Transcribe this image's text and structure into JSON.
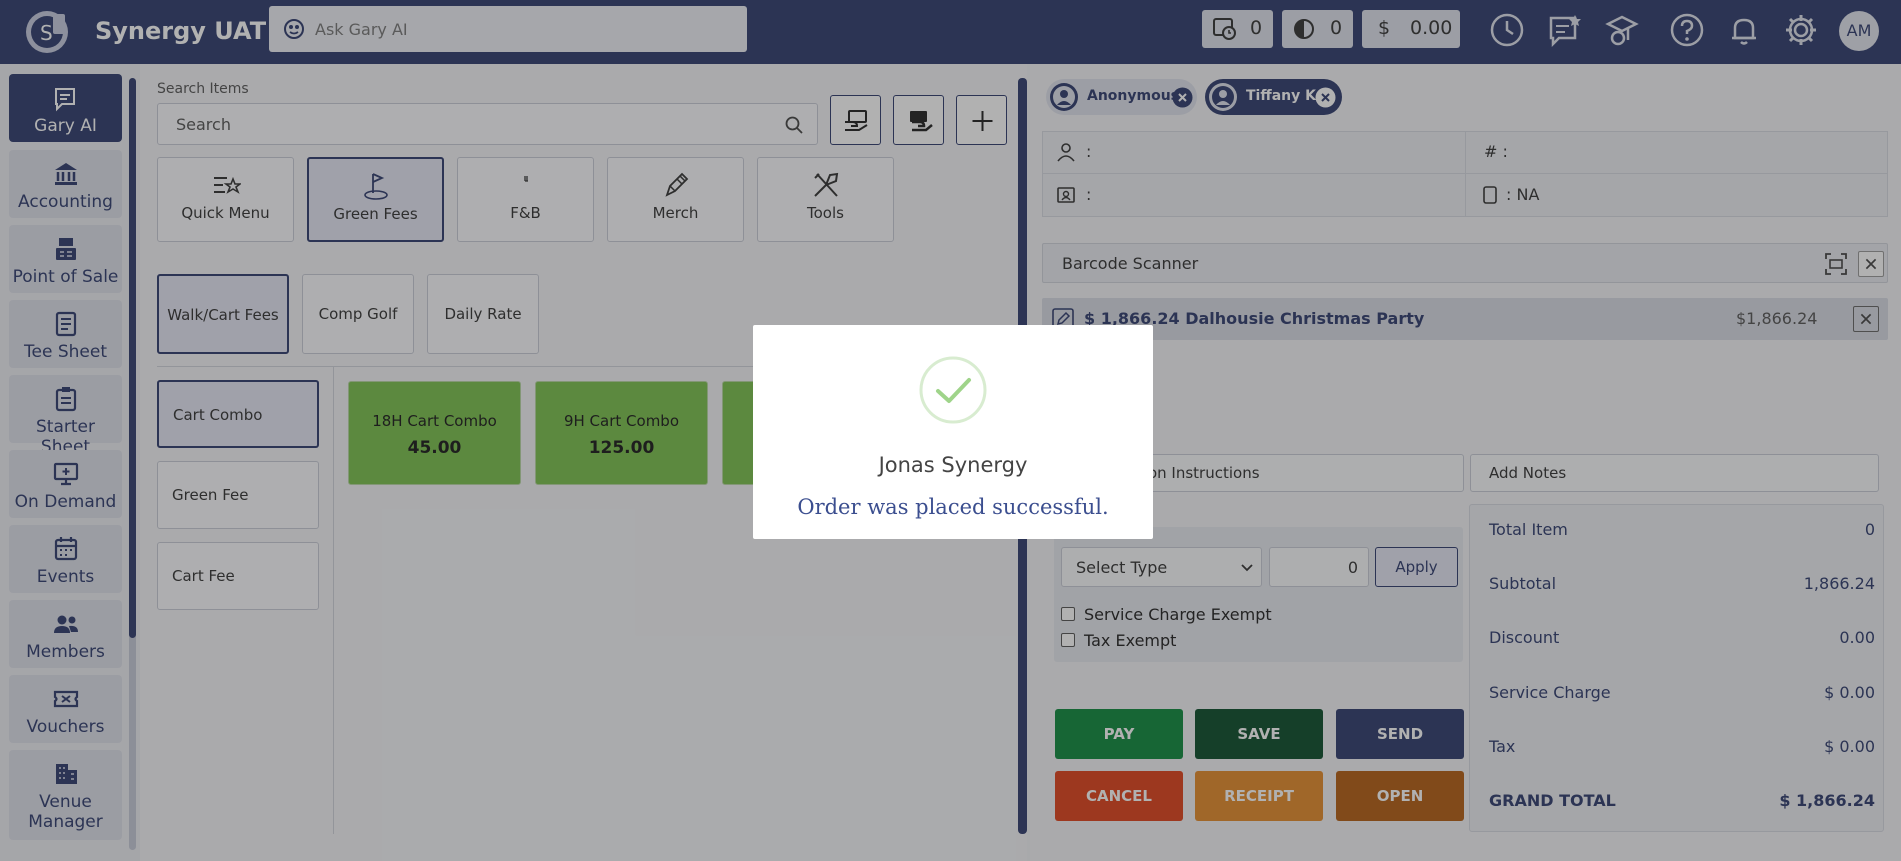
{
  "app": {
    "title": "Synergy UAT"
  },
  "ask": {
    "placeholder": "Ask Gary AI"
  },
  "counters": [
    {
      "icon": "timer-list-icon",
      "value": "0"
    },
    {
      "icon": "pending-icon",
      "value": "0"
    },
    {
      "icon": "dollar-icon",
      "symbol": "$",
      "value": "0.00"
    }
  ],
  "user": {
    "initials": "AM"
  },
  "sidebar": {
    "items": [
      {
        "label": "Gary AI",
        "icon": "ai-chat-icon",
        "active": true
      },
      {
        "label": "Accounting",
        "icon": "bank-icon"
      },
      {
        "label": "Point of Sale",
        "icon": "register-icon"
      },
      {
        "label": "Tee Sheet",
        "icon": "sheet-icon"
      },
      {
        "label": "Starter Sheet",
        "icon": "clipboard-icon"
      },
      {
        "label": "On Demand",
        "icon": "monitor-icon"
      },
      {
        "label": "Events",
        "icon": "calendar-icon"
      },
      {
        "label": "Members",
        "icon": "people-icon"
      },
      {
        "label": "Vouchers",
        "icon": "ticket-icon"
      },
      {
        "label": "Venue",
        "label2": "Manager",
        "icon": "building-icon"
      }
    ]
  },
  "items": {
    "search_label": "Search Items",
    "search_placeholder": "Search",
    "categories": [
      {
        "label": "Quick Menu",
        "icon": "quick-menu-icon"
      },
      {
        "label": "Green Fees",
        "icon": "golf-flag-icon",
        "active": true
      },
      {
        "label": "F&B",
        "icon": "food-icon"
      },
      {
        "label": "Merch",
        "icon": "merch-icon"
      },
      {
        "label": "Tools",
        "icon": "tools-icon"
      }
    ],
    "subcategories": [
      {
        "label": "Walk/Cart Fees",
        "active": true
      },
      {
        "label": "Comp Golf"
      },
      {
        "label": "Daily Rate"
      }
    ],
    "types": [
      {
        "label": "Cart Combo",
        "active": true
      },
      {
        "label": "Green Fee"
      },
      {
        "label": "Cart Fee"
      }
    ],
    "products": [
      {
        "name": "18H Cart Combo",
        "price": "45.00"
      },
      {
        "name": "9H Cart Combo",
        "price": "125.00"
      }
    ]
  },
  "order": {
    "customers": [
      {
        "name": "Anonymous"
      },
      {
        "name": "Tiffany K",
        "active": true
      }
    ],
    "info": {
      "person": ":",
      "number": "# :",
      "card": ":",
      "device": ": NA"
    },
    "barcode_label": "Barcode Scanner",
    "line_item": {
      "description": "$ 1,866.24 Dalhousie Christmas Party",
      "amount": "$1,866.24"
    },
    "prep_instructions": "Preparation Instructions",
    "add_notes": "Add Notes",
    "discount": {
      "select_label": "Select Type",
      "value": "0",
      "apply": "Apply"
    },
    "exemptions": [
      "Service Charge Exempt",
      "Tax Exempt"
    ],
    "buttons": {
      "pay": "PAY",
      "save": "SAVE",
      "send": "SEND",
      "cancel": "CANCEL",
      "receipt": "RECEIPT",
      "open": "OPEN"
    },
    "totals": [
      {
        "label": "Total Item",
        "value": "0"
      },
      {
        "label": "Subtotal",
        "value": "1,866.24"
      },
      {
        "label": "Discount",
        "value": "0.00"
      },
      {
        "label": "Service Charge",
        "value": "$ 0.00"
      },
      {
        "label": "Tax",
        "value": "$ 0.00"
      },
      {
        "label": "GRAND TOTAL",
        "value": "$ 1,866.24"
      }
    ]
  },
  "modal": {
    "title": "Jonas Synergy",
    "message": "Order was placed successful."
  },
  "colors": {
    "brand": "#2f3c6e",
    "pay": "#0f8a3e",
    "save": "#0c4d2b",
    "send": "#2f3c6e",
    "cancel": "#e0421b",
    "receipt": "#e48b2b",
    "open": "#b45f14",
    "product": "#7bc04e"
  }
}
